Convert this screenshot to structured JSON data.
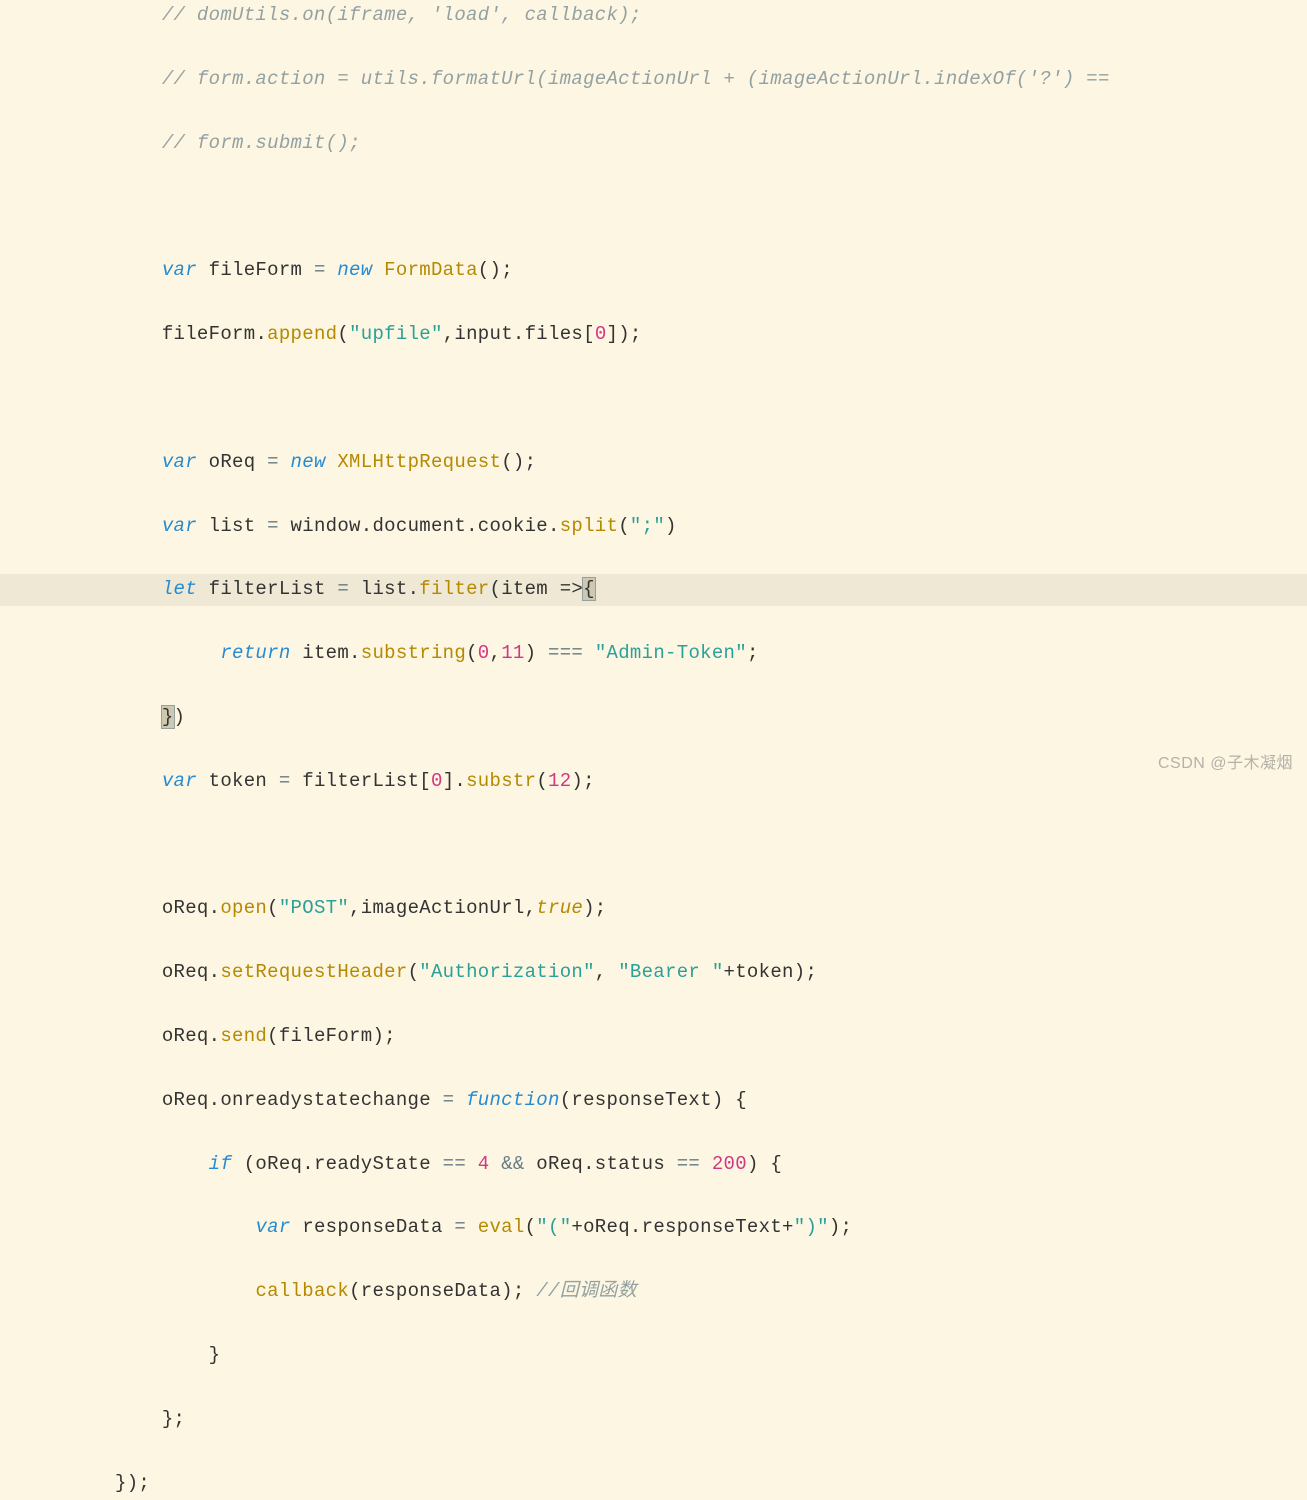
{
  "watermark": "CSDN @子木凝烟",
  "code": {
    "l1_comment": "// domUtils.on(iframe, 'load', callback);",
    "l2_comment": "// form.action = utils.formatUrl(imageActionUrl + (imageActionUrl.indexOf('?') ==",
    "l3_comment": "// form.submit();",
    "l5_kw_var": "var",
    "l5_id_fileForm": " fileForm ",
    "l5_eq": "=",
    "l5_kw_new": " new",
    "l5_fn_FormData": " FormData",
    "l5_paren": "();",
    "l6_id": "fileForm",
    "l6_dot": ".",
    "l6_fn_append": "append",
    "l6_open": "(",
    "l6_str_upfile": "\"upfile\"",
    "l6_comma": ",input.files[",
    "l6_num0": "0",
    "l6_close": "]);",
    "l8_kw_var": "var",
    "l8_txt": " oReq ",
    "l8_eq": "=",
    "l8_kw_new": " new",
    "l8_fn_xhr": " XMLHttpRequest",
    "l8_end": "();",
    "l9_kw_var": "var",
    "l9_txt": " list ",
    "l9_eq": "=",
    "l9_body": " window.document.cookie.",
    "l9_fn_split": "split",
    "l9_open": "(",
    "l9_str": "\";\"",
    "l9_close": ")",
    "l10_kw_let": "let",
    "l10_txt": " filterList ",
    "l10_eq": "=",
    "l10_list": " list.",
    "l10_fn_filter": "filter",
    "l10_arg": "(item =>",
    "l10_brace": "{",
    "l11_kw_return": "return",
    "l11_body": " item.",
    "l11_fn_substr": "substring",
    "l11_open": "(",
    "l11_n0": "0",
    "l11_comma": ",",
    "l11_n11": "11",
    "l11_close": ") ",
    "l11_eqeq": "===",
    "l11_sp": " ",
    "l11_str": "\"Admin-Token\"",
    "l11_semi": ";",
    "l12_close": "}",
    "l12_paren": ")",
    "l13_kw_var": "var",
    "l13_txt": " token ",
    "l13_eq": "=",
    "l13_body": " filterList[",
    "l13_n0": "0",
    "l13_br": "].",
    "l13_fn_substr": "substr",
    "l13_open": "(",
    "l13_n12": "12",
    "l13_close": ");",
    "l15_pre": "oReq.",
    "l15_fn_open": "open",
    "l15_p1": "(",
    "l15_str_post": "\"POST\"",
    "l15_c1": ",imageActionUrl,",
    "l15_true": "true",
    "l15_end": ");",
    "l16_pre": "oReq.",
    "l16_fn_srh": "setRequestHeader",
    "l16_p1": "(",
    "l16_str_auth": "\"Authorization\"",
    "l16_c": ", ",
    "l16_str_bearer": "\"Bearer \"",
    "l16_end": "+token);",
    "l17_pre": "oReq.",
    "l17_fn_send": "send",
    "l17_arg": "(fileForm);",
    "l18_pre": "oReq.onreadystatechange ",
    "l18_eq": "=",
    "l18_sp": " ",
    "l18_kw_fn": "function",
    "l18_arg": "(responseText) {",
    "l19_kw_if": "if",
    "l19_a": " (oReq.readyState ",
    "l19_eq1": "==",
    "l19_sp1": " ",
    "l19_n4": "4",
    "l19_sp2": " ",
    "l19_and": "&&",
    "l19_b": " oReq.status ",
    "l19_eq2": "==",
    "l19_sp3": " ",
    "l19_n200": "200",
    "l19_end": ") {",
    "l20_kw_var": "var",
    "l20_a": " responseData ",
    "l20_eq": "=",
    "l20_sp": " ",
    "l20_fn_eval": "eval",
    "l20_p": "(",
    "l20_str1": "\"(\"",
    "l20_mid": "+oReq.responseText+",
    "l20_str2": "\")\"",
    "l20_end": ");",
    "l21_fn_cb": "callback",
    "l21_arg": "(responseData); ",
    "l21_cmt": "//回调函数",
    "l22_close": "}",
    "l23_close": "};",
    "l24_close": "});"
  }
}
